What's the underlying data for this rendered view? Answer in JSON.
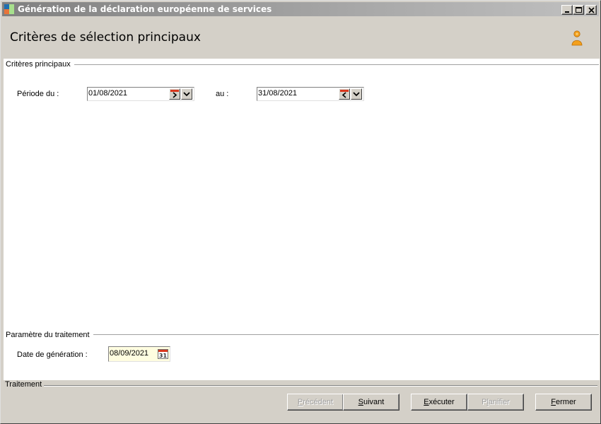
{
  "window": {
    "title": "Génération de la déclaration européenne de services"
  },
  "header": {
    "title": "Critères de sélection principaux"
  },
  "sections": {
    "main_criteria": {
      "label": "Critères principaux",
      "period_from_label": "Période du :",
      "period_from_value": "01/08/2021",
      "period_to_label": "au :",
      "period_to_value": "31/08/2021"
    },
    "processing_params": {
      "label": "Paramètre du traitement",
      "generation_date_label": "Date de génération :",
      "generation_date_value": "08/09/2021",
      "calendar_day": "31"
    },
    "processing": {
      "label": "Traitement"
    }
  },
  "buttons": {
    "previous": {
      "mnemonic": "P",
      "rest": "récédent",
      "enabled": false
    },
    "next": {
      "mnemonic": "S",
      "rest": "uivant",
      "enabled": true
    },
    "execute": {
      "mnemonic": "E",
      "rest": "xécuter",
      "enabled": true
    },
    "schedule": {
      "pre": "P",
      "mnemonic": "l",
      "rest": "anifier",
      "enabled": false
    },
    "close": {
      "mnemonic": "F",
      "rest": "ermer",
      "enabled": true
    }
  },
  "colors": {
    "title_bar": "#808080",
    "field_highlight": "#fffde0",
    "calendar_red": "#d9381e",
    "user_icon": "#f4a01c"
  },
  "icons": {
    "app": "app-icon",
    "user": "user-icon",
    "minimize": "minimize-icon",
    "maximize": "maximize-icon",
    "close": "close-icon",
    "next_day": "calendar-next-icon",
    "prev_day": "calendar-prev-icon",
    "dropdown": "chevron-down-icon",
    "calendar": "calendar-icon"
  }
}
